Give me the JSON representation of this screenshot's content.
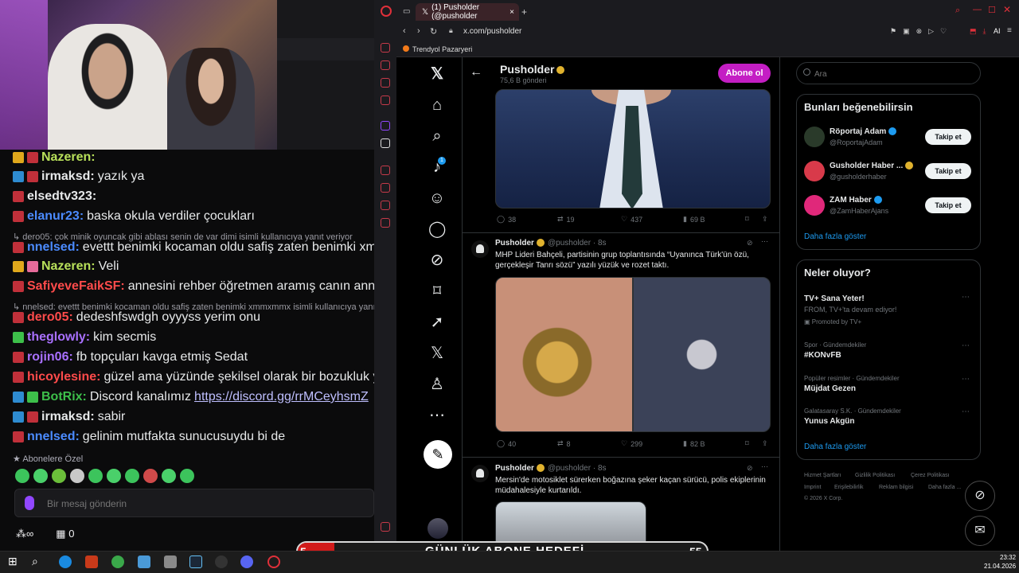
{
  "chat": {
    "messages": [
      {
        "user": "Nazeren:",
        "text": "",
        "color": "#b8e05a"
      },
      {
        "user": "irmaksd:",
        "text": "yazık ya",
        "color": "#e7e9ea"
      },
      {
        "user": "elsedtv323:",
        "text": "",
        "color": "#e7e9ea"
      },
      {
        "user": "elanur23:",
        "text": "baska okula verdiler çocukları",
        "color": "#4b8bff"
      },
      {
        "user": "",
        "text": "dero05: çok minik oyuncak gibi ablası senin de var dimi isimli kullanıcıya yanıt veriyor",
        "color": "#9b9ba3"
      },
      {
        "user": "nnelsed:",
        "text": "evettt benimki kocaman oldu safiş zaten benimki xmmxmmx",
        "color": "#4b8bff"
      },
      {
        "user": "Nazeren:",
        "text": "Veli",
        "color": "#b8e05a"
      },
      {
        "user": "SafiyeveFaikSF:",
        "text": "annesini rehber öğretmen aramış canın annesi telefonu yüzüne kapa",
        "color": "#ff4b4b"
      },
      {
        "user": "",
        "text": "nnelsed: evettt benimki kocaman oldu safiş zaten benimki xmmxmmx isimli kullanıcıya yanıt",
        "color": "#9b9ba3"
      },
      {
        "user": "dero05:",
        "text": "dedeshfswdgh oyyyss yerim onu",
        "color": "#ff4b4b"
      },
      {
        "user": "theglowly:",
        "text": "kim secmis",
        "color": "#a970ff"
      },
      {
        "user": "rojin06:",
        "text": "fb topçuları kavga etmiş Sedat",
        "color": "#a970ff"
      },
      {
        "user": "hicoylesine:",
        "text": "güzel ama yüzünde şekilsel olarak bir bozukluk yok",
        "color": "#ff4b4b"
      },
      {
        "user": "BotRix:",
        "text": "Discord kanalımız",
        "link": "https://discord.gg/rrMCeyhsmZ",
        "color": "#3dbf4a"
      },
      {
        "user": "irmaksd:",
        "text": "sabir",
        "color": "#e7e9ea"
      },
      {
        "user": "nnelsed:",
        "text": "gelinim mutfakta sunucusuydu bi de",
        "color": "#4b8bff"
      }
    ],
    "subscribers_label": "Abonelere Özel",
    "input_placeholder": "Bir mesaj gönderin",
    "viewer_count": "0"
  },
  "browser": {
    "tab_title": "(1) Pusholder (@pusholder",
    "url": "x.com/pusholder",
    "bookmark": "Trendyol Pazaryeri"
  },
  "profile": {
    "name": "Pusholder",
    "posts": "75,6 B gönderi",
    "subscribe": "Abone ol"
  },
  "tweets": [
    {
      "replies": "38",
      "retweets": "19",
      "likes": "437",
      "views": "69 B"
    },
    {
      "name": "Pusholder",
      "handle": "@pusholder",
      "time": "· 8s",
      "text": "MHP Lideri Bahçeli, partisinin grup toplantısında “Uyanınca Türk'ün özü, gerçekleşir Tanrı sözü” yazılı yüzük ve rozet taktı.",
      "replies": "40",
      "retweets": "8",
      "likes": "299",
      "views": "82 B"
    },
    {
      "name": "Pusholder",
      "handle": "@pusholder",
      "time": "· 8s",
      "text": "Mersin'de motosiklet sürerken boğazına şeker kaçan sürücü, polis ekiplerinin müdahalesiyle kurtarıldı."
    }
  ],
  "sidebar": {
    "search_placeholder": "Ara",
    "who_to_follow_title": "Bunları beğenebilirsin",
    "suggestions": [
      {
        "name": "Röportaj Adam",
        "handle": "@RoportajAdam",
        "button": "Takip et",
        "color": "#2a3a2a"
      },
      {
        "name": "Gusholder Haber ...",
        "handle": "@gusholderhaber",
        "button": "Takip et",
        "color": "#d83a4a"
      },
      {
        "name": "ZAM Haber",
        "handle": "@ZamHaberAjans",
        "button": "Takip et",
        "color": "#e0287a"
      }
    ],
    "show_more_1": "Daha fazla göster",
    "trends_title": "Neler oluyor?",
    "trends": [
      {
        "meta": "",
        "name": "TV+ Sana Yeter!",
        "sub": "FROM, TV+'ta devam ediyor!",
        "promo": "Promoted by TV+"
      },
      {
        "meta": "Spor · Gündemdekiler",
        "name": "#KONvFB"
      },
      {
        "meta": "Popüler resimler · Gündemdekiler",
        "name": "Müjdat Gezen"
      },
      {
        "meta": "Galatasaray S.K. · Gündemdekiler",
        "name": "Yunus Akgün"
      }
    ],
    "show_more_2": "Daha fazla göster",
    "footer": [
      "Hizmet Şartları",
      "Gizlilik Politikası",
      "Çerez Politikası",
      "Imprint",
      "Erişilebilirlik",
      "Reklam bilgisi",
      "Daha fazla ...",
      "© 2026 X Corp."
    ]
  },
  "goal": {
    "start": "5",
    "label": "GÜNLÜK ABONE HEDEFİ",
    "end": "55",
    "progress_percent": 9
  },
  "taskbar": {
    "time": "23:32",
    "date": "21.04.2026"
  }
}
